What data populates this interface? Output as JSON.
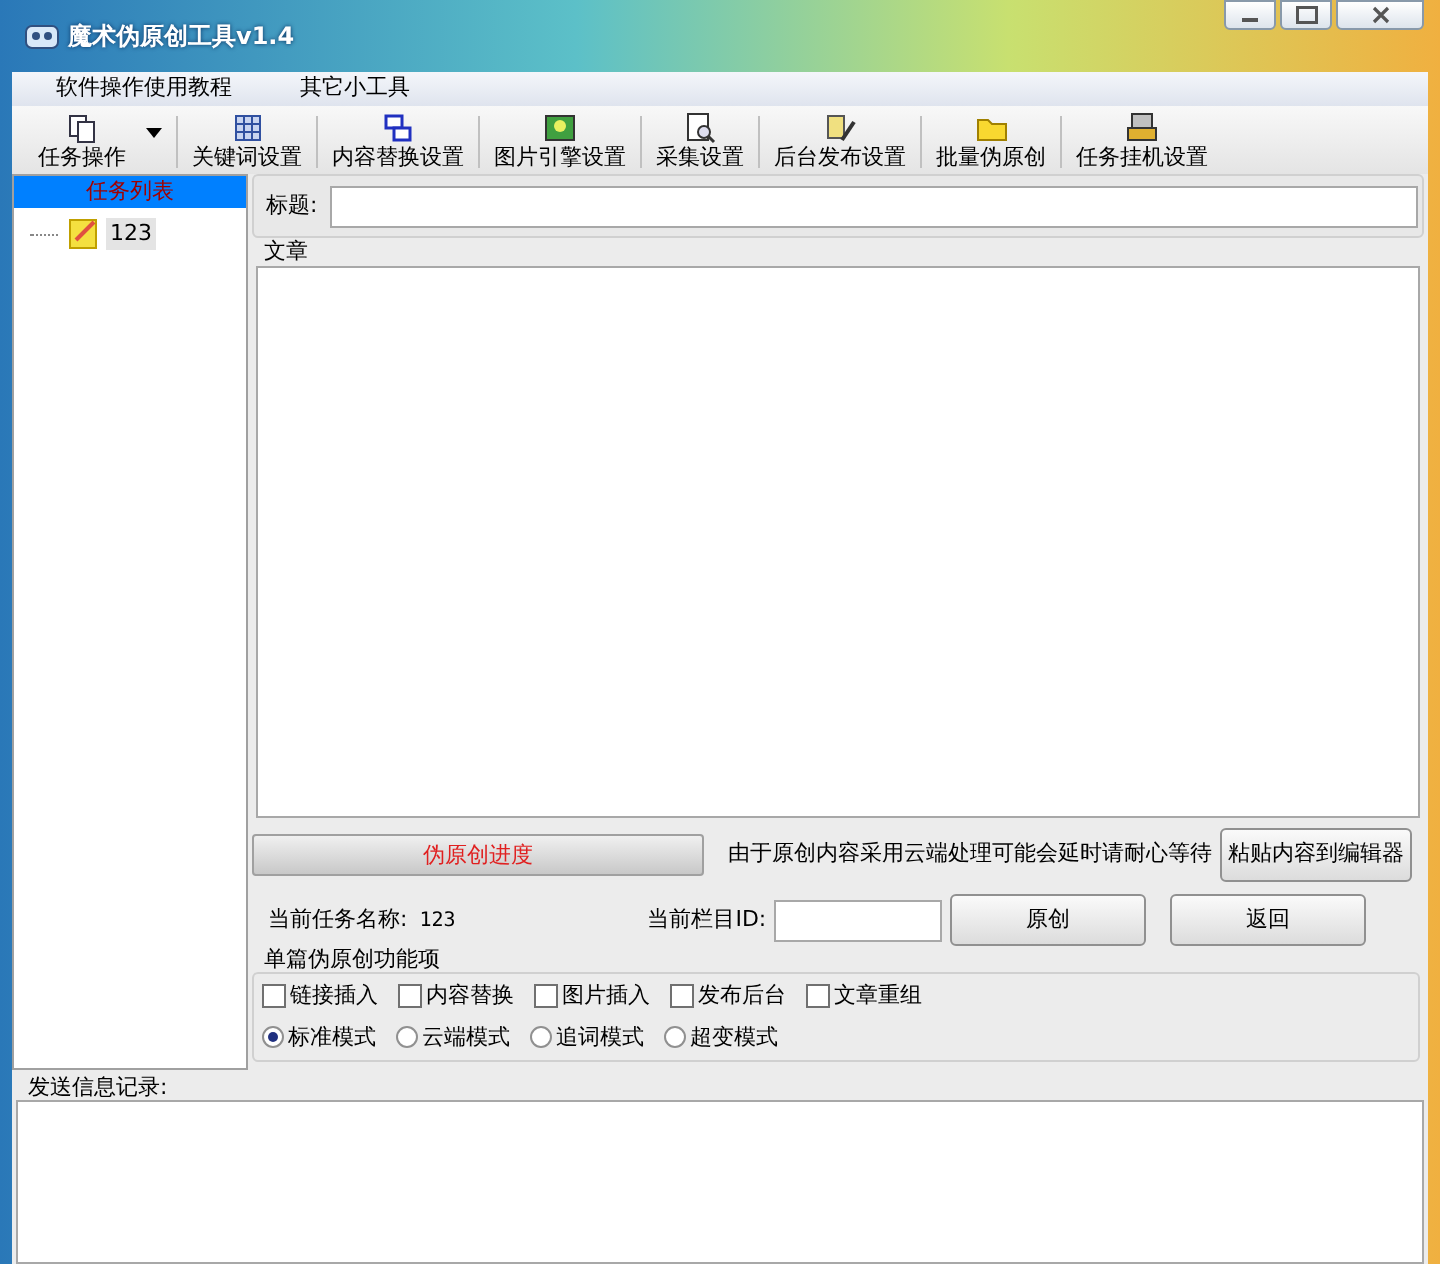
{
  "window": {
    "title": "魔术伪原创工具v1.4"
  },
  "menu": [
    "软件操作使用教程",
    "其它小工具"
  ],
  "toolbar": [
    {
      "label": "任务操作",
      "kind": "pages",
      "dropdown": true
    },
    {
      "label": "关键词设置",
      "kind": "grid",
      "dropdown": false
    },
    {
      "label": "内容替换设置",
      "kind": "windows",
      "dropdown": false
    },
    {
      "label": "图片引擎设置",
      "kind": "image",
      "dropdown": false
    },
    {
      "label": "采集设置",
      "kind": "search",
      "dropdown": false
    },
    {
      "label": "后台发布设置",
      "kind": "pencil",
      "dropdown": false
    },
    {
      "label": "批量伪原创",
      "kind": "folder",
      "dropdown": false
    },
    {
      "label": "任务挂机设置",
      "kind": "machine",
      "dropdown": false
    }
  ],
  "task_list": {
    "header": "任务列表",
    "items": [
      {
        "label": "123",
        "selected": true
      }
    ]
  },
  "title_field": {
    "label": "标题:"
  },
  "article": {
    "label": "文章"
  },
  "progress": {
    "label": "伪原创进度",
    "level": 0
  },
  "notice": "由于原创内容采用云端处理可能会延时请耐心等待",
  "paste_button": "粘贴内容到编辑器",
  "current_task": {
    "label": "当前任务名称:",
    "value": "123"
  },
  "column_id": {
    "label": "当前栏目ID:"
  },
  "original_button": "原创",
  "back_button": "返回",
  "options": {
    "title": "单篇伪原创功能项",
    "checkboxes": [
      {
        "label": "链接插入",
        "checked": false
      },
      {
        "label": "内容替换",
        "checked": false
      },
      {
        "label": "图片插入",
        "checked": false
      },
      {
        "label": "发布后台",
        "checked": false
      },
      {
        "label": "文章重组",
        "checked": false
      }
    ],
    "modes": [
      {
        "label": "标准模式",
        "selected": true
      },
      {
        "label": "云端模式",
        "selected": false
      },
      {
        "label": "追词模式",
        "selected": false
      },
      {
        "label": "超变模式",
        "selected": false
      }
    ]
  },
  "log": {
    "label": "发送信息记录:"
  }
}
